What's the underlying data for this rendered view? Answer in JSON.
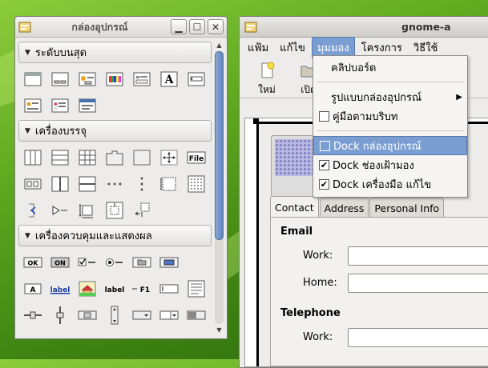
{
  "palette": {
    "title": "กล่องอุปกรณ์",
    "groups": [
      {
        "title": "ระดับบนสุด"
      },
      {
        "title": "เครื่องบรรจุ"
      },
      {
        "title": "เครื่องควบคุมและแสดงผล"
      }
    ],
    "toplevel_icons": [
      "window-icon",
      "dialog-icon",
      "message-dialog-icon",
      "color-dialog-icon",
      "file-chooser-icon",
      "font-dialog-icon",
      "input-dialog-icon",
      "about-dialog-icon",
      "assistant-icon",
      "recent-chooser-icon"
    ],
    "container_icons": [
      "hbox-icon",
      "vbox-icon",
      "table-icon",
      "notebook-icon",
      "frame-icon",
      "fixed-icon",
      "file-label-icon",
      "toolbar-icon",
      "hpaned-icon",
      "vpaned-icon",
      "button-box-icon",
      "vbutton-box-icon",
      "layout-icon",
      "dotted-grid-icon",
      "expander-icon",
      "play-arrow-icon",
      "resize-icon",
      "alignment-icon",
      "event-box-icon"
    ],
    "control_icons": [
      "ok-button-icon",
      "toggle-on-button-icon",
      "check-button-icon",
      "radio-button-icon",
      "file-chooser-button-icon",
      "color-button-icon",
      "a-label-icon",
      "link-label-icon",
      "image-icon",
      "label-icon",
      "font-button-icon",
      "entry-icon",
      "textview-icon",
      "hscale-icon",
      "vscale-icon",
      "spin-button-icon",
      "vspin-icon",
      "combo-icon",
      "combo-entry-icon",
      "progress-icon"
    ],
    "labels": {
      "ok": "OK",
      "on": "ON",
      "file": "File",
      "a": "A",
      "link": "label",
      "plain": "label",
      "f1": "F1"
    }
  },
  "main": {
    "title": "gnome-a",
    "menu": [
      "แฟ้ม",
      "แก้ไข",
      "มุมมอง",
      "โครงการ",
      "วิธีใช้"
    ],
    "active_menu": "มุมมอง",
    "toolbar": [
      {
        "icon": "new-icon",
        "label": "ใหม่"
      },
      {
        "icon": "open-icon",
        "label": "เปิด"
      }
    ],
    "tabs": [
      "Contact",
      "Address",
      "Personal Info"
    ],
    "active_tab": "Contact",
    "sections": {
      "email": "Email",
      "telephone": "Telephone"
    },
    "fields": {
      "work": "Work:",
      "home": "Home:",
      "phone_work": "Work:"
    }
  },
  "view_menu": {
    "items": [
      {
        "label": "คลิปบอร์ด",
        "kind": "plain"
      },
      {
        "label": "รูปแบบกล่องอุปกรณ์",
        "kind": "submenu"
      },
      {
        "label": "คู่มือตามบริบท",
        "kind": "check",
        "checked": false
      },
      {
        "label": "Dock กล่องอุปกรณ์",
        "kind": "check",
        "checked": false,
        "highlighted": true
      },
      {
        "label": "Dock ช่องเฝ้ามอง",
        "kind": "check",
        "checked": true
      },
      {
        "label": "Dock เครื่องมือ แก้ไข",
        "kind": "check",
        "checked": true
      }
    ]
  },
  "colors": {
    "highlight": "#7b9ed2",
    "desktop": "#5ea81f"
  }
}
